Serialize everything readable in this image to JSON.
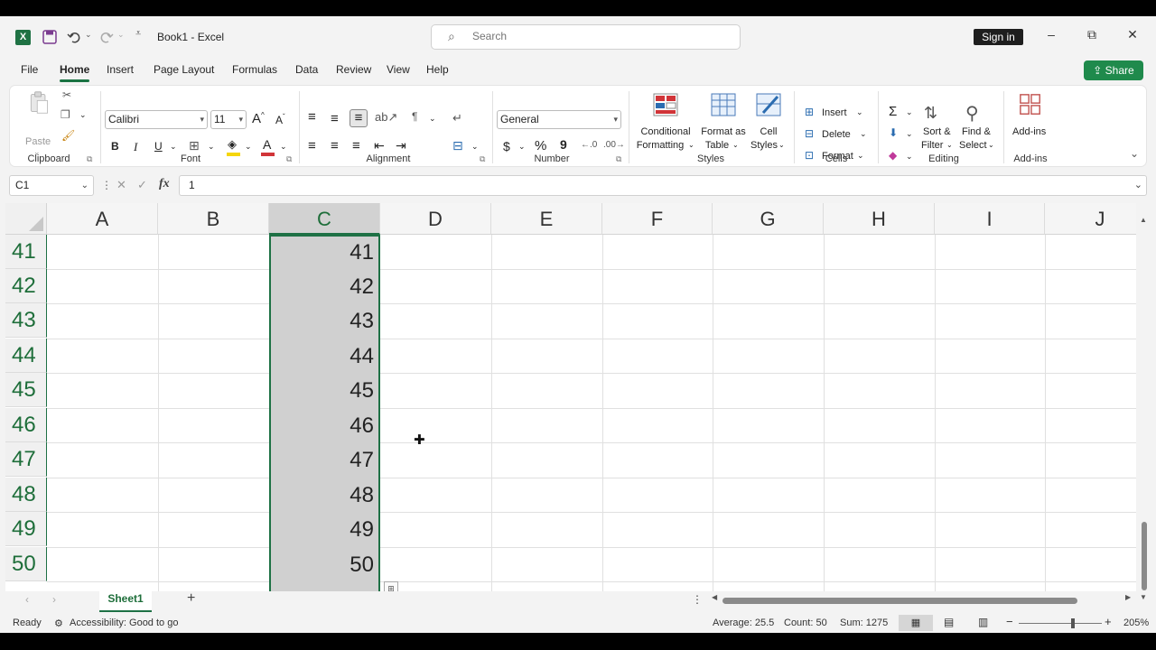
{
  "window": {
    "doc_title": "Book1  -  Excel",
    "search_placeholder": "Search",
    "signin_label": "Sign in",
    "minimize": "–",
    "restore": "⧉",
    "close": "✕"
  },
  "menu": {
    "tabs": [
      "File",
      "Home",
      "Insert",
      "Page Layout",
      "Formulas",
      "Data",
      "Review",
      "View",
      "Help"
    ],
    "active": "Home",
    "share_label": "Share"
  },
  "ribbon": {
    "clipboard": {
      "label": "Clipboard",
      "paste": "Paste"
    },
    "font": {
      "label": "Font",
      "family": "Calibri",
      "size": "11",
      "bold": "B",
      "italic": "I",
      "underline": "U",
      "grow": "A",
      "shrink": "A"
    },
    "alignment": {
      "label": "Alignment"
    },
    "number": {
      "label": "Number",
      "format": "General",
      "currency": "$",
      "percent": "%",
      "comma": "9"
    },
    "styles": {
      "label": "Styles",
      "conditional_1": "Conditional",
      "conditional_2": "Formatting",
      "format_table_1": "Format as",
      "format_table_2": "Table",
      "cell_styles_1": "Cell",
      "cell_styles_2": "Styles"
    },
    "cells": {
      "label": "Cells",
      "insert": "Insert",
      "delete": "Delete",
      "format": "Format"
    },
    "editing": {
      "label": "Editing",
      "sort_1": "Sort &",
      "sort_2": "Filter",
      "find_1": "Find &",
      "find_2": "Select"
    },
    "addins": {
      "label": "Add-ins",
      "button": "Add-ins"
    }
  },
  "formula_bar": {
    "name_box": "C1",
    "fx": "fx",
    "value": "1"
  },
  "grid": {
    "columns": [
      "A",
      "B",
      "C",
      "D",
      "E",
      "F",
      "G",
      "H",
      "I",
      "J"
    ],
    "selected_column": "C",
    "rows": [
      "41",
      "42",
      "43",
      "44",
      "45",
      "46",
      "47",
      "48",
      "49",
      "50"
    ],
    "c_values": [
      "41",
      "42",
      "43",
      "44",
      "45",
      "46",
      "47",
      "48",
      "49",
      "50"
    ]
  },
  "sheets": {
    "tabs": [
      "Sheet1"
    ],
    "add": "+"
  },
  "status": {
    "ready": "Ready",
    "accessibility": "Accessibility: Good to go",
    "average": "Average: 25.5",
    "count": "Count: 50",
    "sum": "Sum: 1275",
    "zoom": "205%"
  },
  "colors": {
    "accent": "#1e7145",
    "share": "#1f8a4c",
    "selection": "#d0d0d0"
  }
}
